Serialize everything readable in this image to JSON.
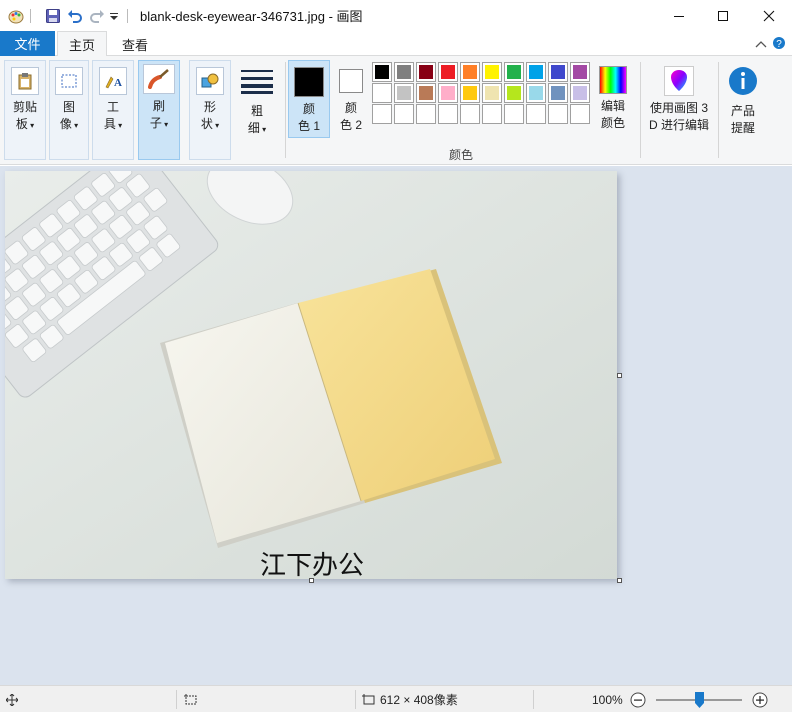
{
  "window": {
    "title": "blank-desk-eyewear-346731.jpg - 画图",
    "buttons": [
      "minimize",
      "maximize",
      "close"
    ]
  },
  "quick_access": {
    "icons": [
      "paint-app-icon",
      "save-icon",
      "undo-icon",
      "redo-icon",
      "customize-dropdown-icon"
    ]
  },
  "tabs": {
    "file": "文件",
    "home": "主页",
    "view": "查看"
  },
  "ribbon": {
    "clipboard": {
      "line1": "剪贴",
      "line2": "板"
    },
    "image": {
      "line1": "图",
      "line2": "像"
    },
    "tools": {
      "line1": "工",
      "line2": "具"
    },
    "brush": {
      "line1": "刷",
      "line2": "子"
    },
    "shapes": {
      "line1": "形",
      "line2": "状"
    },
    "size": {
      "line1": "粗",
      "line2": "细"
    },
    "color1": {
      "line1": "颜",
      "line2": "色 1"
    },
    "color2": {
      "line1": "颜",
      "line2": "色 2"
    },
    "edit_colors": {
      "line1": "编辑",
      "line2": "颜色"
    },
    "paint3d": {
      "line1": "使用画图 3",
      "line2": "D 进行编辑"
    },
    "product_alert": {
      "line1": "产品",
      "line2": "提醒"
    },
    "colors_group_caption": "颜色",
    "color1_value": "#000000",
    "color2_value": "#ffffff",
    "palette": [
      "#000000",
      "#7f7f7f",
      "#880015",
      "#ed1c24",
      "#ff7f27",
      "#fff200",
      "#22b14c",
      "#00a2e8",
      "#3f48cc",
      "#a349a4",
      "#ffffff",
      "#c3c3c3",
      "#b97a57",
      "#ffaec9",
      "#ffc90e",
      "#efe4b0",
      "#b5e61d",
      "#99d9ea",
      "#7092be",
      "#c8bfe7",
      "",
      "",
      "",
      "",
      "",
      "",
      "",
      "",
      "",
      ""
    ]
  },
  "canvas": {
    "overlay_text": "江下办公"
  },
  "statusbar": {
    "dimensions": "612 × 408像素",
    "zoom": "100%",
    "zoom_level": 0.5
  }
}
